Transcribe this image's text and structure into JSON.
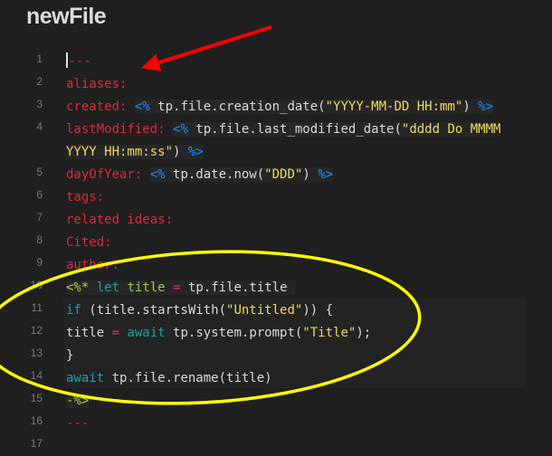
{
  "file": {
    "title": "newFile"
  },
  "lines": [
    {
      "n": "1",
      "text": "---"
    },
    {
      "n": "2",
      "key": "aliases:"
    },
    {
      "n": "3",
      "key": "created:",
      "open": "<%",
      "code": " tp.file.creation_date(",
      "str": "\"YYYY-MM-DD HH:mm\"",
      "close_paren": ") ",
      "close": "%>"
    },
    {
      "n": "4",
      "key": "lastModified:",
      "open": "<%",
      "code": " tp.file.last_modified_date(",
      "str": "\"dddd Do MMMM YYYY HH:mm:ss\"",
      "close_paren": ") ",
      "close": "%>"
    },
    {
      "n": "5",
      "key": "dayOfYear:",
      "open": "<%",
      "code": " tp.date.now(",
      "str": "\"DDD\"",
      "close_paren": ") ",
      "close": "%>"
    },
    {
      "n": "6",
      "key": "tags:"
    },
    {
      "n": "7",
      "key": "related ideas:"
    },
    {
      "n": "8",
      "key": "Cited:"
    },
    {
      "n": "9",
      "key": "author:"
    },
    {
      "n": "10",
      "open": "<%*",
      "kw": "let",
      "var": "title",
      "eq": "=",
      "code": "tp.file.title"
    },
    {
      "n": "11",
      "kw": "if",
      "code": " (title.startsWith(",
      "str": "\"Untitled\"",
      "tail": ")) {"
    },
    {
      "n": "12",
      "code": "title ",
      "eq": "=",
      "kw": "await",
      "code2": " tp.system.prompt(",
      "str": "\"Title\"",
      "tail": ");"
    },
    {
      "n": "13",
      "code": "}"
    },
    {
      "n": "14",
      "kw": "await",
      "code": " tp.file.rename(title)"
    },
    {
      "n": "15",
      "close": "-%>"
    },
    {
      "n": "16",
      "text": "---"
    },
    {
      "n": "17"
    }
  ],
  "annotations": {
    "arrow_color": "#ff0000",
    "ellipse_color": "#ffff00"
  }
}
